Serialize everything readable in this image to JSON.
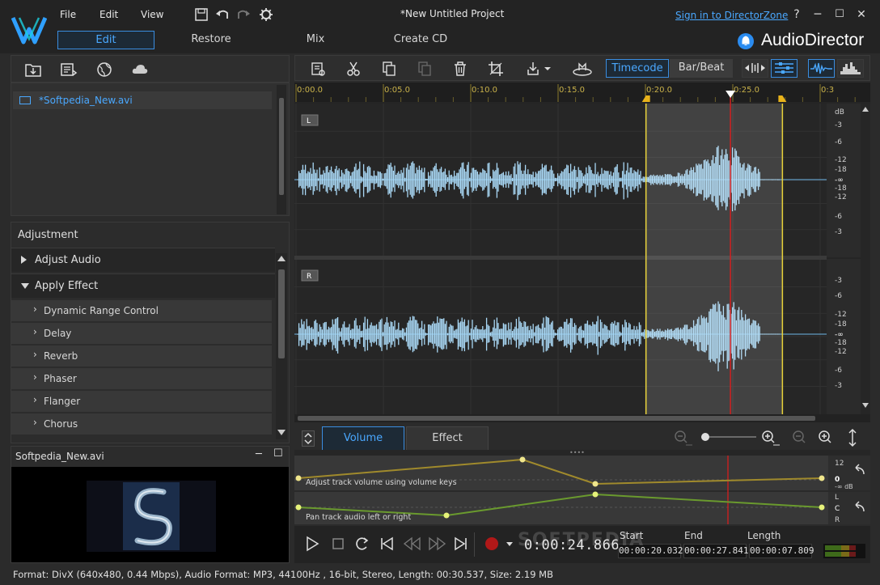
{
  "app": {
    "name": "AudioDirector",
    "project_title": "*New Untitled Project",
    "sign_in_link": "Sign in to DirectorZone",
    "help": "?",
    "menu": [
      "File",
      "Edit",
      "View"
    ],
    "mode_tabs": [
      "Edit",
      "Restore",
      "Mix",
      "Create CD"
    ],
    "accent": "#3a8de0"
  },
  "library": {
    "items": [
      {
        "label": "*Softpedia_New.avi"
      }
    ]
  },
  "adjustment": {
    "title": "Adjustment",
    "sections": [
      {
        "label": "Adjust Audio",
        "expanded": false
      },
      {
        "label": "Apply Effect",
        "expanded": true
      }
    ],
    "effects": [
      "Dynamic Range Control",
      "Delay",
      "Reverb",
      "Phaser",
      "Flanger",
      "Chorus"
    ]
  },
  "preview": {
    "title": "Softpedia_New.avi"
  },
  "toolbar": {
    "timecode_label": "Timecode",
    "barbeat_label": "Bar/Beat"
  },
  "timeline": {
    "ruler_labels": [
      "0:00.0",
      "0:05.0",
      "0:10.0",
      "0:15.0",
      "0:20.0",
      "0:25.0",
      "0:3"
    ],
    "channels": [
      {
        "label": "L",
        "db_labels": [
          "dB",
          "-3",
          "-6",
          "-12",
          "-18",
          "-∞",
          "-18",
          "-12",
          "-6",
          "-3"
        ]
      },
      {
        "label": "R",
        "db_labels": [
          "-3",
          "-6",
          "-12",
          "-18",
          "-∞",
          "-18",
          "-12",
          "-6",
          "-3"
        ]
      }
    ],
    "selection_start": "00:00:20.032",
    "selection_end": "00:00:27.841",
    "playhead": "0:00:24.866"
  },
  "lower": {
    "tabs": [
      "Volume",
      "Effect"
    ],
    "volume_hint": "Adjust track volume using volume keys",
    "pan_hint": "Pan track audio left or right",
    "volume_scale": [
      "12",
      "0",
      "-∞ dB"
    ],
    "pan_scale": [
      "L",
      "C",
      "R"
    ]
  },
  "transport": {
    "current_time": "0:00:24.866",
    "start_label": "Start",
    "end_label": "End",
    "length_label": "Length",
    "start": "00:00:20.032",
    "end": "00:00:27.841",
    "length": "00:00:07.809"
  },
  "watermark": "SOFTPEDIA",
  "status": "Format: DivX (640x480, 0.44 Mbps), Audio Format: MP3, 44100Hz , 16-bit, Stereo, Length: 00:30.537, Size: 2.19 MB"
}
